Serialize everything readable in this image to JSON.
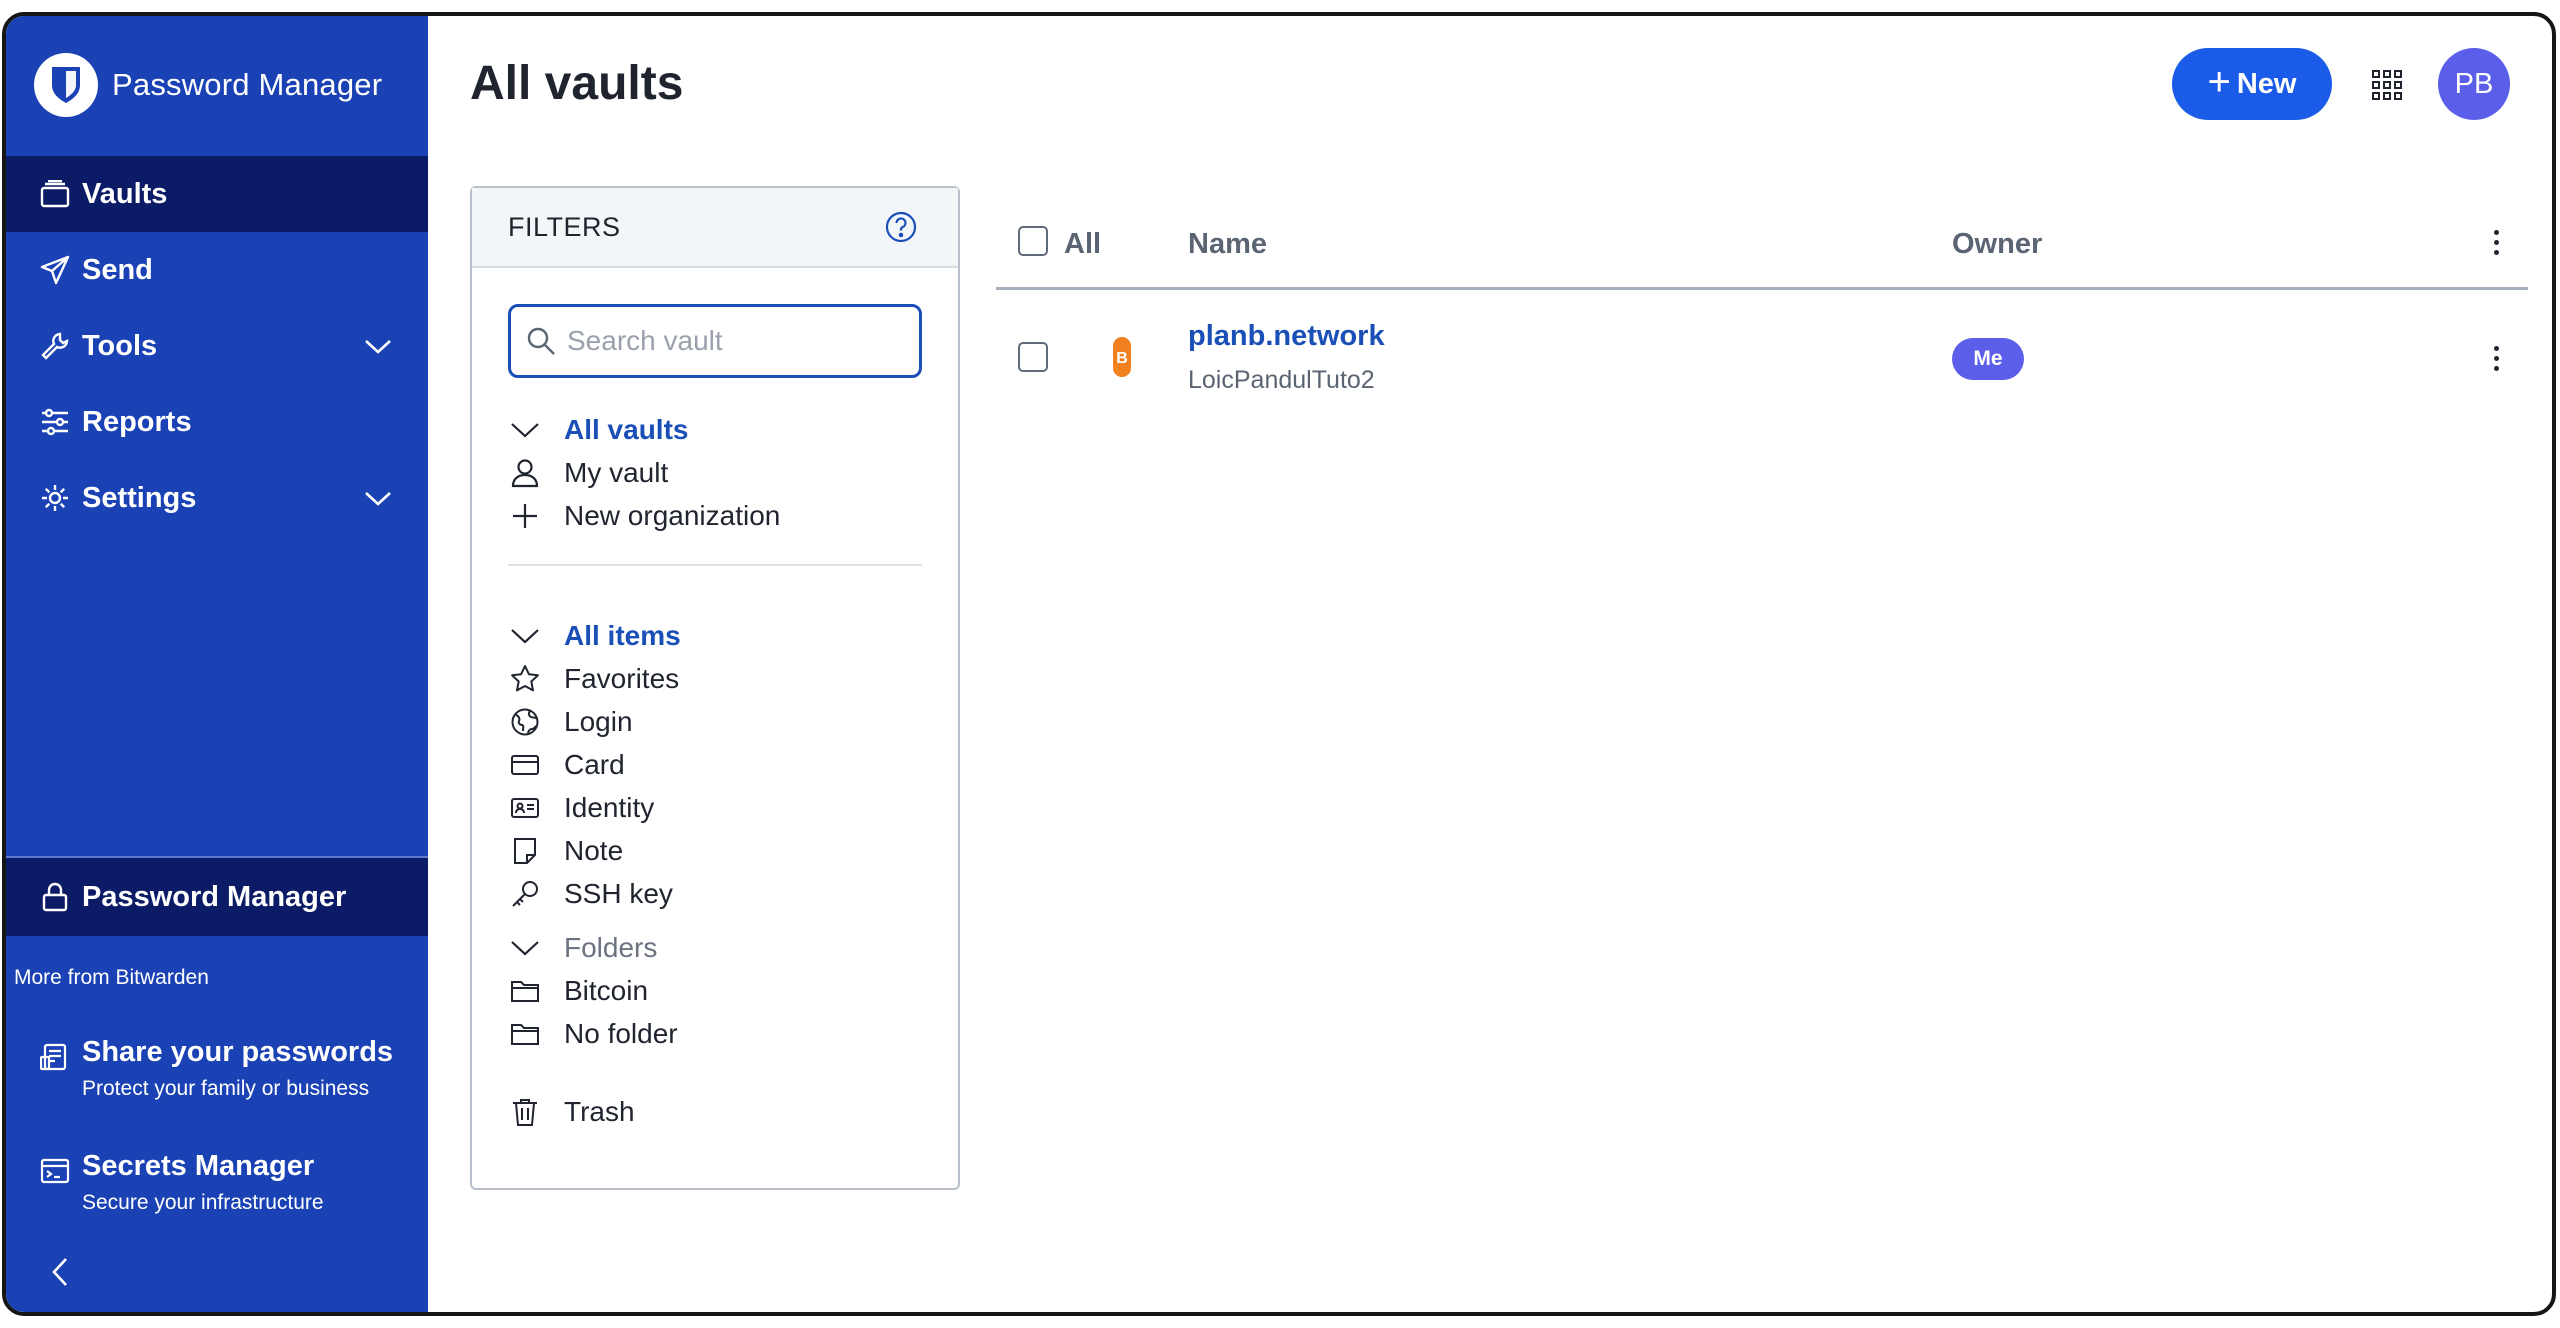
{
  "sidebar": {
    "brand": "Password Manager",
    "nav": [
      {
        "label": "Vaults",
        "icon": "vault-icon",
        "active": true
      },
      {
        "label": "Send",
        "icon": "send-icon"
      },
      {
        "label": "Tools",
        "icon": "wrench-icon",
        "expandable": true
      },
      {
        "label": "Reports",
        "icon": "sliders-icon"
      },
      {
        "label": "Settings",
        "icon": "gear-icon",
        "expandable": true
      }
    ],
    "current_product": "Password Manager",
    "more_label": "More from Bitwarden",
    "products": [
      {
        "title": "Share your passwords",
        "subtitle": "Protect your family or business"
      },
      {
        "title": "Secrets Manager",
        "subtitle": "Secure your infrastructure"
      }
    ]
  },
  "header": {
    "title": "All vaults",
    "new_label": "New",
    "avatar_initials": "PB"
  },
  "filters": {
    "title": "FILTERS",
    "search_placeholder": "Search vault",
    "vaults_heading": "All vaults",
    "vaults": [
      "My vault",
      "New organization"
    ],
    "items_heading": "All items",
    "types": [
      "Favorites",
      "Login",
      "Card",
      "Identity",
      "Note",
      "SSH key"
    ],
    "folders_heading": "Folders",
    "folders": [
      "Bitcoin",
      "No folder"
    ],
    "trash": "Trash"
  },
  "table": {
    "col_all": "All",
    "col_name": "Name",
    "col_owner": "Owner",
    "rows": [
      {
        "name": "planb.network",
        "subtitle": "LoicPandulTuto2",
        "owner": "Me",
        "icon": "bitcoin-favicon-icon"
      }
    ]
  },
  "colors": {
    "sidebar": "#1a42b4",
    "sidebar_active": "#0c1b66",
    "primary": "#1a5ce8",
    "link": "#1a4fb8",
    "avatar": "#5a5ee8"
  }
}
